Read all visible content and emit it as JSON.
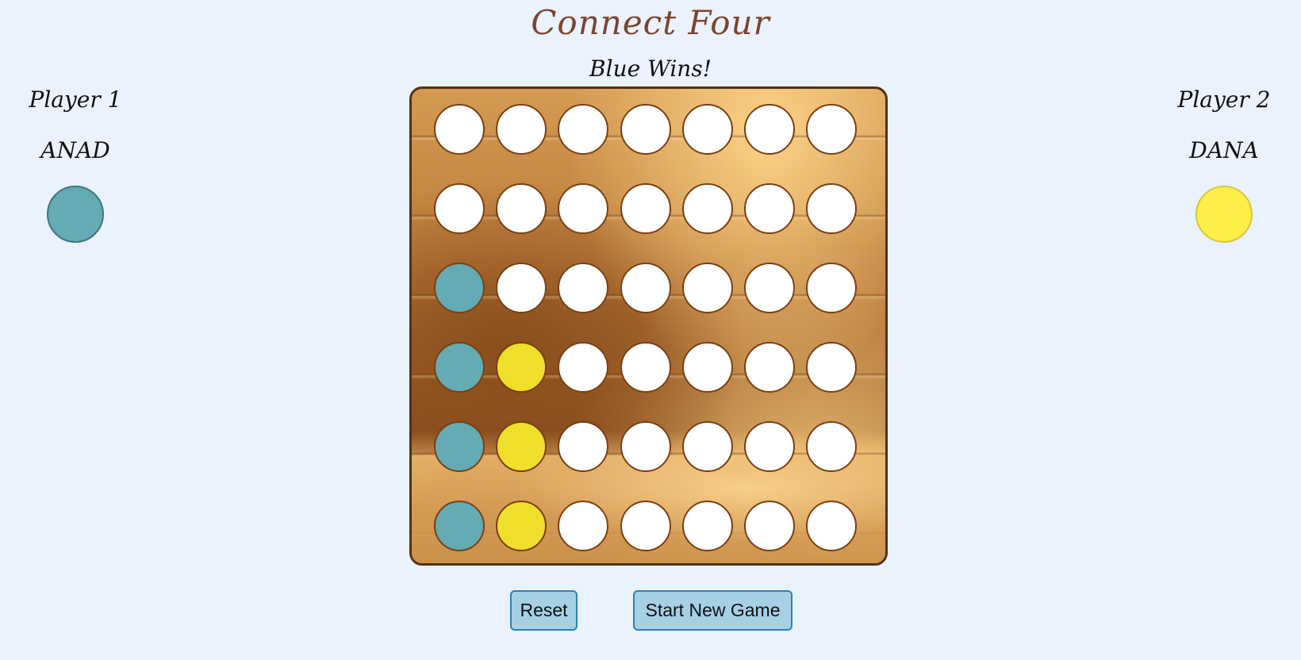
{
  "title": "Connect Four",
  "status": "Blue Wins!",
  "players": [
    {
      "label": "Player 1",
      "name": "ANAD",
      "color": "#64abb3",
      "border": "#3f7680"
    },
    {
      "label": "Player 2",
      "name": "DANA",
      "color": "#fdee48",
      "border": "#d6c93a"
    }
  ],
  "colors": {
    "empty": "#ffffff",
    "blue": "#64abb3",
    "yellow": "#efdf2a",
    "background": "#eaf2fd"
  },
  "board": {
    "rows": 6,
    "cols": 7,
    "cells": [
      [
        "empty",
        "empty",
        "empty",
        "empty",
        "empty",
        "empty",
        "empty"
      ],
      [
        "empty",
        "empty",
        "empty",
        "empty",
        "empty",
        "empty",
        "empty"
      ],
      [
        "blue",
        "empty",
        "empty",
        "empty",
        "empty",
        "empty",
        "empty"
      ],
      [
        "blue",
        "yellow",
        "empty",
        "empty",
        "empty",
        "empty",
        "empty"
      ],
      [
        "blue",
        "yellow",
        "empty",
        "empty",
        "empty",
        "empty",
        "empty"
      ],
      [
        "blue",
        "yellow",
        "empty",
        "empty",
        "empty",
        "empty",
        "empty"
      ]
    ]
  },
  "controls": {
    "reset_label": "Reset",
    "new_game_label": "Start New Game"
  }
}
